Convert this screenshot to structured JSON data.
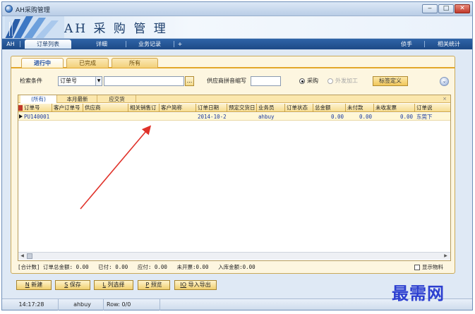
{
  "window": {
    "title": "AH采购管理",
    "minimize": "‒",
    "maximize": "□",
    "close": "✕"
  },
  "banner": {
    "title": "AH 采 购 管 理"
  },
  "mainbar": {
    "ah": "AH",
    "tabs": [
      "订单列表",
      "详细",
      "业务记录"
    ],
    "plus": "+",
    "assistant": "侦手",
    "stats": "相关统计"
  },
  "status_tabs": [
    "进行中",
    "已完成",
    "所有"
  ],
  "search": {
    "label": "检索条件",
    "field_value": "订单号",
    "query_value": "",
    "dots": "...",
    "supplier_label": "供应商拼音缩写",
    "supplier_value": "",
    "radio_purchase": "采购",
    "radio_outsource": "外发加工",
    "tag_button": "标签定义",
    "expand_icon": "chevron-double-down-icon",
    "expand_glyph": "⌄"
  },
  "grid": {
    "tabs": [
      "(所有)",
      "本月最新",
      "应交货"
    ],
    "close": "×",
    "columns": [
      "订单号",
      "客户订单号",
      "供应商",
      "相关销售订",
      "客户简称",
      "订单日期",
      "预定交货日",
      "业务员",
      "订单状态",
      "总金额",
      "未付款",
      "未收发票",
      "订单说"
    ],
    "rows": [
      [
        "PU140001",
        "",
        "",
        "",
        "",
        "2014-10-2",
        "",
        "ahbuy",
        "",
        "0.00",
        "0.00",
        "0.00",
        "东莞下"
      ]
    ],
    "scroll_left": "◀",
    "scroll_right": "▶"
  },
  "summary": {
    "text": "[合计数] 订单总金额: 0.00   已付: 0.00   应付: 0.00   未开票:0.00   入库金额:0.00",
    "show_items_label": "显示物料"
  },
  "actions": [
    {
      "key": "N",
      "label": "新建"
    },
    {
      "key": "S",
      "label": "保存"
    },
    {
      "key": "L",
      "label": "列选择"
    },
    {
      "key": "P",
      "label": "预览"
    },
    {
      "key": "IO",
      "label": "导入导出"
    }
  ],
  "status_bar": {
    "time": "14:17:28",
    "user": "ahbuy",
    "row": "Row: 0/0"
  },
  "watermark": "最需网",
  "colors": {
    "accent": "#1d4a86",
    "panel": "#fdf6e0",
    "highlight": "#e3a72a",
    "watermark": "#2c3fd0"
  }
}
